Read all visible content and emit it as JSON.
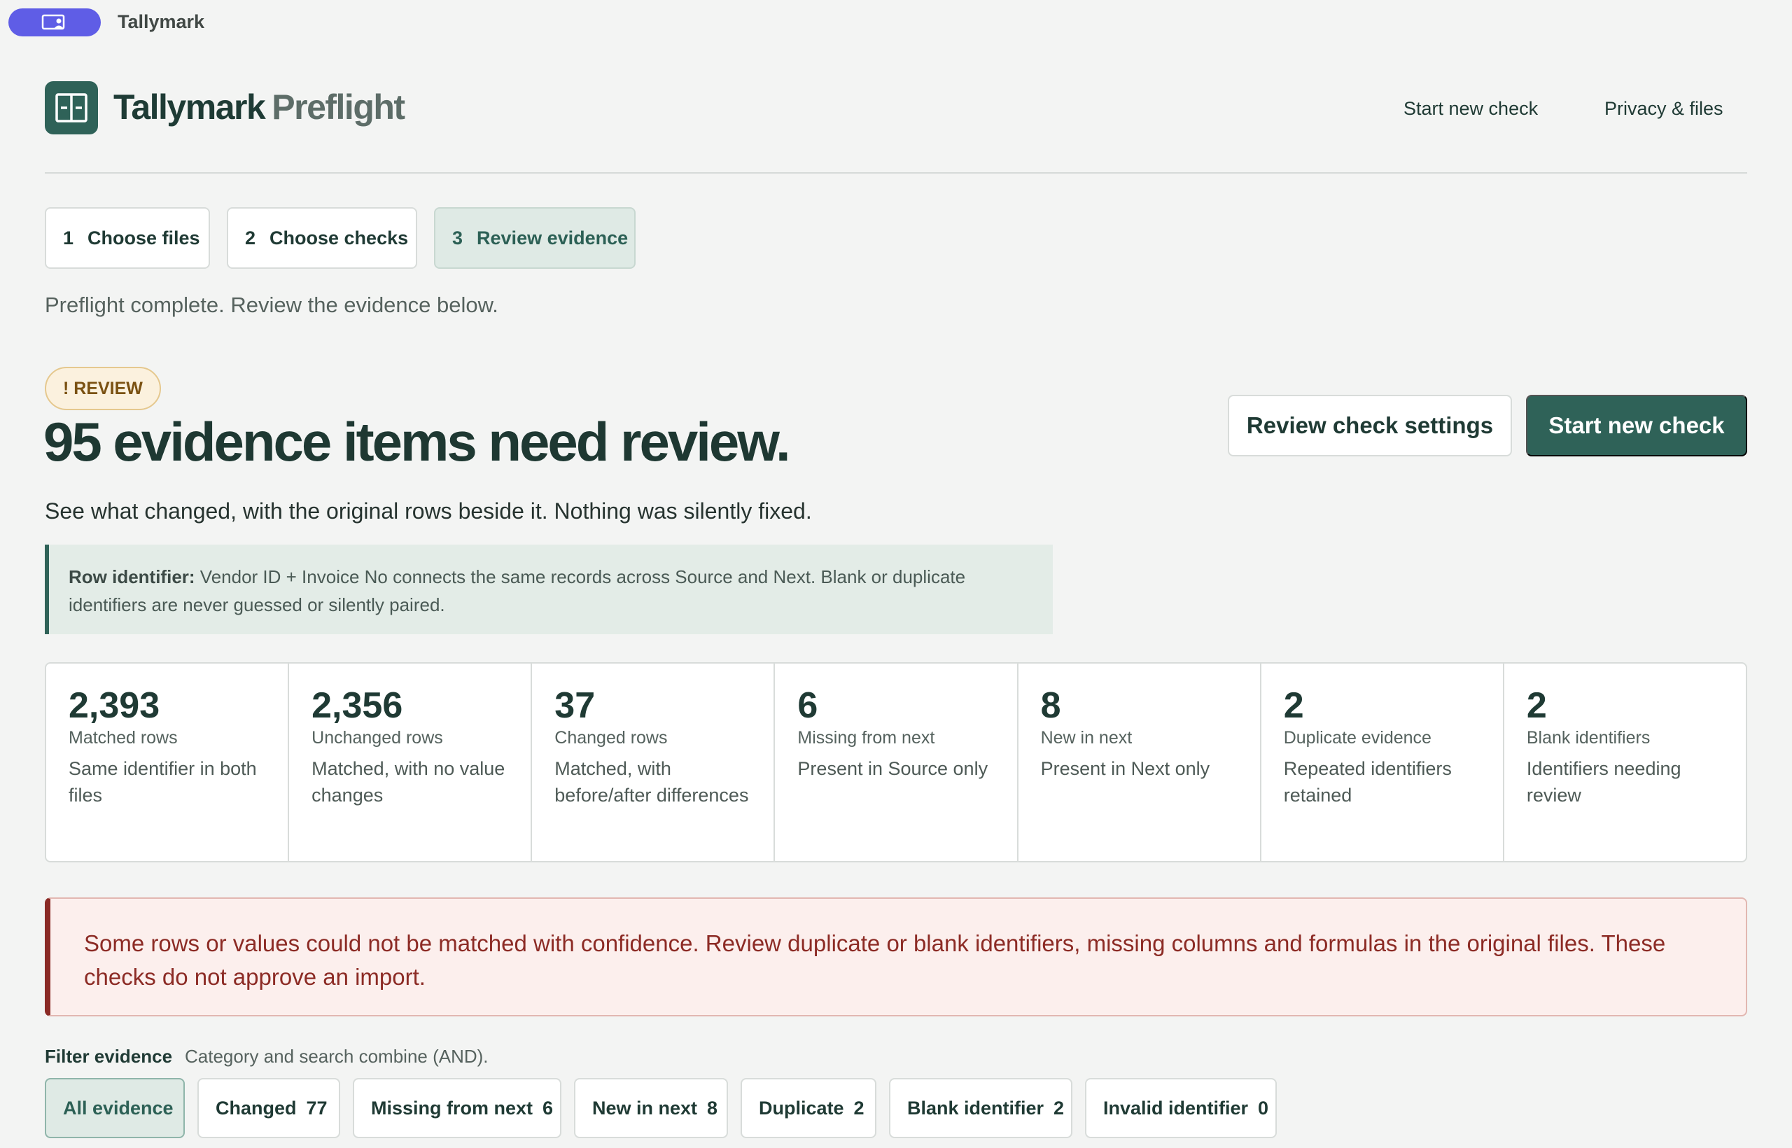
{
  "window": {
    "app_name": "Tallymark",
    "accent": "#5f5de6"
  },
  "header": {
    "brand_primary": "Tallymark",
    "brand_secondary": "Preflight",
    "nav": [
      {
        "label": "Start new check"
      },
      {
        "label": "Privacy & files"
      }
    ]
  },
  "steps": [
    {
      "num": "1",
      "label": "Choose files",
      "active": false
    },
    {
      "num": "2",
      "label": "Choose checks",
      "active": false
    },
    {
      "num": "3",
      "label": "Review evidence",
      "active": true
    }
  ],
  "status_text": "Preflight complete. Review the evidence below.",
  "review": {
    "badge": "! REVIEW",
    "headline": "95 evidence items need review.",
    "subline": "See what changed, with the original rows beside it. Nothing was silently fixed.",
    "btn_settings": "Review check settings",
    "btn_new": "Start new check"
  },
  "identifier_note": {
    "label": "Row identifier:",
    "text": " Vendor ID + Invoice No connects the same records across Source and Next. Blank or duplicate identifiers are never guessed or silently paired."
  },
  "stats": [
    {
      "value": "2,393",
      "label": "Matched rows",
      "desc": "Same identifier in both files"
    },
    {
      "value": "2,356",
      "label": "Unchanged rows",
      "desc": "Matched, with no value changes"
    },
    {
      "value": "37",
      "label": "Changed rows",
      "desc": "Matched, with before/after differences"
    },
    {
      "value": "6",
      "label": "Missing from next",
      "desc": "Present in Source only"
    },
    {
      "value": "8",
      "label": "New in next",
      "desc": "Present in Next only"
    },
    {
      "value": "2",
      "label": "Duplicate evidence",
      "desc": "Repeated identifiers retained"
    },
    {
      "value": "2",
      "label": "Blank identifiers",
      "desc": "Identifiers needing review"
    }
  ],
  "alert": "Some rows or values could not be matched with confidence. Review duplicate or blank identifiers, missing columns and formulas in the original files. These checks do not approve an import.",
  "filter": {
    "title": "Filter evidence",
    "hint": "Category and search combine (AND).",
    "chips": [
      {
        "label": "All evidence",
        "count": "",
        "active": true
      },
      {
        "label": "Changed",
        "count": "77",
        "active": false
      },
      {
        "label": "Missing from next",
        "count": "6",
        "active": false
      },
      {
        "label": "New in next",
        "count": "8",
        "active": false
      },
      {
        "label": "Duplicate",
        "count": "2",
        "active": false
      },
      {
        "label": "Blank identifier",
        "count": "2",
        "active": false
      },
      {
        "label": "Invalid identifier",
        "count": "0",
        "active": false
      }
    ]
  },
  "colors": {
    "brand": "#2f6258",
    "warning_bg": "#fbf1de",
    "alert_text": "#8c2b25"
  }
}
